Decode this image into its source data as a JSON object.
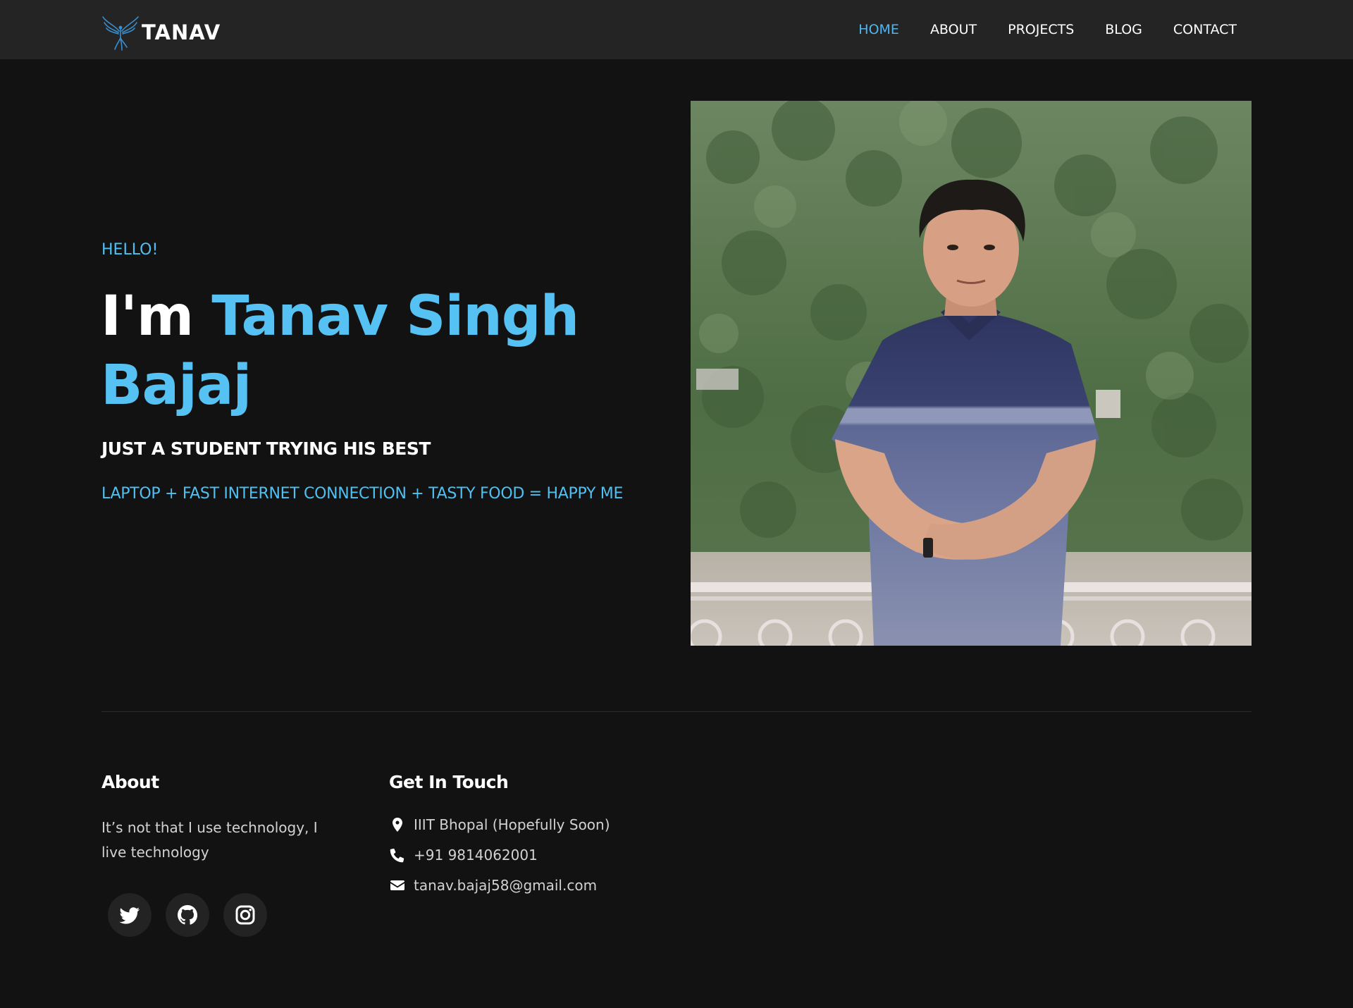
{
  "brand": {
    "name": "TANAV",
    "logo_icon": "phoenix-logo-icon"
  },
  "nav": {
    "items": [
      {
        "label": "HOME",
        "active": true
      },
      {
        "label": "ABOUT",
        "active": false
      },
      {
        "label": "PROJECTS",
        "active": false
      },
      {
        "label": "BLOG",
        "active": false
      },
      {
        "label": "CONTACT",
        "active": false
      }
    ]
  },
  "hero": {
    "greeting": "HELLO!",
    "intro": "I'm ",
    "name": "Tanav Singh Bajaj",
    "tagline": "JUST A STUDENT TRYING HIS BEST",
    "equation": "LAPTOP + FAST INTERNET CONNECTION + TASTY FOOD = HAPPY ME",
    "portrait_alt": "portrait-photo"
  },
  "footer": {
    "about": {
      "heading": "About",
      "text": "It’s not that I use technology, I live technology"
    },
    "socials": [
      {
        "icon": "twitter-icon"
      },
      {
        "icon": "github-icon"
      },
      {
        "icon": "instagram-icon"
      }
    ],
    "contact": {
      "heading": "Get In Touch",
      "address": "IIIT Bhopal (Hopefully Soon)",
      "phone": "+91 9814062001",
      "email": "tanav.bajaj58@gmail.com"
    }
  },
  "colors": {
    "accent": "#4fc0f2",
    "background": "#121212",
    "navbar": "#242424",
    "text": "#ffffff"
  }
}
